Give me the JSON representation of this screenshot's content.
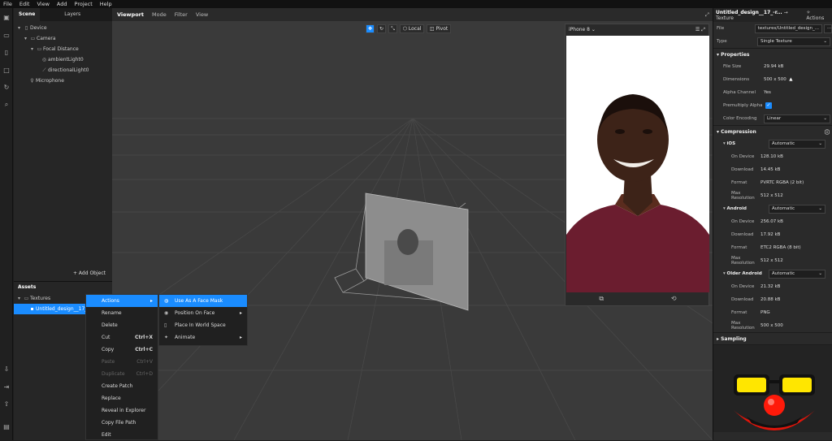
{
  "menu": {
    "file": "File",
    "edit": "Edit",
    "view": "View",
    "add": "Add",
    "project": "Project",
    "help": "Help"
  },
  "scene": {
    "tab_scene": "Scene",
    "tab_layers": "Layers",
    "tree": [
      "Device",
      "Camera",
      "Focal Distance",
      "ambientLight0",
      "directionalLight0",
      "Microphone"
    ],
    "add_object": "+ Add Object"
  },
  "assets": {
    "title": "Assets",
    "folder": "Textures",
    "file": "Untitled_design__17_"
  },
  "viewport": {
    "tab_viewport": "Viewport",
    "tab_mode": "Mode",
    "tab_filter": "Filter",
    "tab_view": "View",
    "local": "Local",
    "pivot": "Pivot",
    "device": "iPhone 8"
  },
  "context_menu": {
    "actions": "Actions",
    "rename": "Rename",
    "delete": "Delete",
    "cut": "Cut",
    "cut_sc": "Ctrl+X",
    "copy": "Copy",
    "copy_sc": "Ctrl+C",
    "paste": "Paste",
    "paste_sc": "Ctrl+V",
    "duplicate": "Duplicate",
    "duplicate_sc": "Ctrl+D",
    "create_patch": "Create Patch",
    "replace": "Replace",
    "reveal": "Reveal in Explorer",
    "copy_path": "Copy File Path",
    "edit": "Edit"
  },
  "submenu": {
    "face_mask": "Use As A Face Mask",
    "position_face": "Position On Face",
    "place_world": "Place In World Space",
    "animate": "Animate"
  },
  "inspector": {
    "title": "Untitled_design__17_-r...",
    "kind": "→ Texture",
    "actions": "Actions",
    "file_label": "File",
    "file_value": "textures/Untitled_design_...",
    "more": "···",
    "type_label": "Type",
    "type_value": "Single Texture",
    "properties": "Properties",
    "file_size_label": "File Size",
    "file_size": "29.94 kB",
    "dimensions_label": "Dimensions",
    "dimensions": "500 x 500",
    "alpha_label": "Alpha Channel",
    "alpha": "Yes",
    "premultiply_label": "Premultiply Alpha",
    "encoding_label": "Color Encoding",
    "encoding": "Linear",
    "compression": "Compression",
    "ios": "iOS",
    "ios_mode": "Automatic",
    "ios_on_device": "128.10 kB",
    "ios_download": "14.45 kB",
    "ios_format": "PVRTC RGBA (2 bit)",
    "ios_maxres": "512 x 512",
    "android": "Android",
    "android_mode": "Automatic",
    "android_on_device": "256.07 kB",
    "android_download": "17.92 kB",
    "android_format": "ETC2 RGBA (8 bit)",
    "android_maxres": "512 x 512",
    "older": "Older Android",
    "older_mode": "Automatic",
    "older_on_device": "21.32 kB",
    "older_download": "20.88 kB",
    "older_format": "PNG",
    "older_maxres": "500 x 500",
    "on_device_label": "On Device",
    "download_label": "Download",
    "format_label": "Format",
    "maxres_label": "Max Resolution",
    "sampling": "Sampling"
  },
  "colors": {
    "accent": "#1a8cff",
    "shirt": "#6b1d2f",
    "skin": "#3d2318"
  }
}
